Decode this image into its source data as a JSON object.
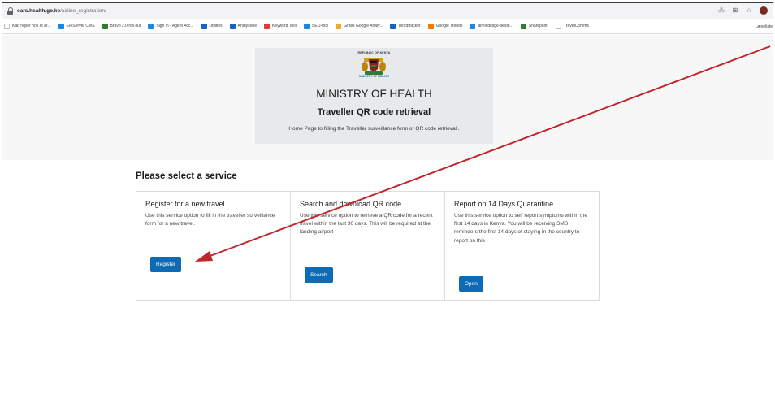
{
  "browser": {
    "url_domain": "ears.health.go.ke",
    "url_path": "/airline_registration/",
    "bookmarks": [
      {
        "label": "Kab rejser hos et af...",
        "color": "#ffffff"
      },
      {
        "label": "EPiServer CMS",
        "color": "#1e88e5"
      },
      {
        "label": "Bravo 2.0 roll out",
        "color": "#2e7d32"
      },
      {
        "label": "Sign in - Agent Acc...",
        "color": "#1e88e5"
      },
      {
        "label": "Utilities",
        "color": "#1565c0"
      },
      {
        "label": "Analysehe",
        "color": "#1565c0"
      },
      {
        "label": "Keyword Tool",
        "color": "#e53935"
      },
      {
        "label": "SEO-tool",
        "color": "#1e88e5"
      },
      {
        "label": "Gratis Google Analy...",
        "color": "#f9a825"
      },
      {
        "label": "Wordtracker",
        "color": "#1565c0"
      },
      {
        "label": "Google Trends",
        "color": "#f57c00"
      },
      {
        "label": "almindelige-beste...",
        "color": "#1e88e5"
      },
      {
        "label": "Sharepoint",
        "color": "#2e7d32"
      },
      {
        "label": "TravelComms",
        "color": "#ffffff"
      }
    ],
    "bookmarks_right": "Læseliste"
  },
  "header": {
    "seal_caption": "REPUBLIC OF KENYA",
    "ministry_caption": "MINISTRY OF HEALTH",
    "title": "MINISTRY OF HEALTH",
    "subtitle": "Traveller QR code retrieval",
    "description": "Home Page to filling the Traveller surveillance form or QR code retrieval ."
  },
  "services": {
    "heading": "Please select a service",
    "cards": [
      {
        "title": "Register for a new travel",
        "description": "Use this service option to fill in the traveller surveillance form for a new travel.",
        "button": "Register"
      },
      {
        "title": "Search and download QR code",
        "description": "Use this service option to retrieve a QR code for a recent travel within the last 30 days. This will be required at the landing airport",
        "button": "Search"
      },
      {
        "title": "Report on 14 Days Quarantine",
        "description": "Use this service option to self report symptoms within the first 14 days in Kenya. You will be receiving SMS reminders the first 14 days of staying in the country to report on this",
        "button": "Open"
      }
    ]
  },
  "colors": {
    "primary_button": "#0d6ab5",
    "annotation_arrow": "#c0272d"
  }
}
